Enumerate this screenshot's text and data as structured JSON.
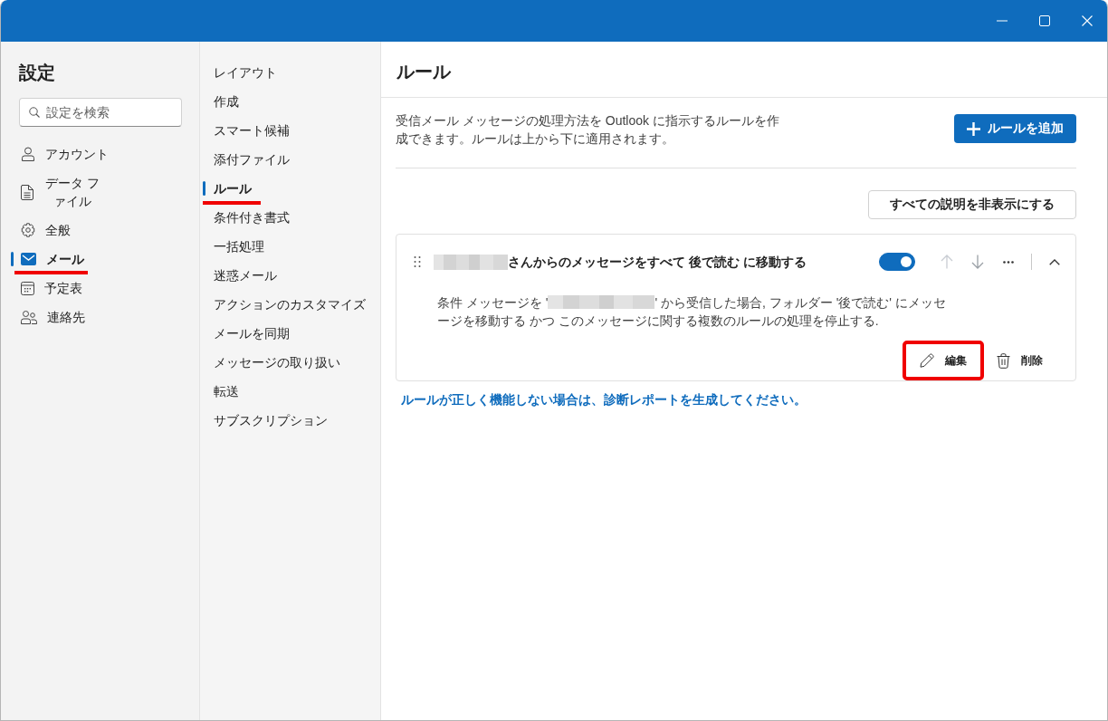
{
  "sidebar": {
    "title": "設定",
    "search": {
      "placeholder": "設定を検索"
    },
    "items": [
      {
        "label": "アカウント",
        "selected": false,
        "annotated": false
      },
      {
        "label": "データ ファイル",
        "selected": false,
        "annotated": false
      },
      {
        "label": "全般",
        "selected": false,
        "annotated": false
      },
      {
        "label": "メール",
        "selected": true,
        "annotated": true
      },
      {
        "label": "予定表",
        "selected": false,
        "annotated": false
      },
      {
        "label": "連絡先",
        "selected": false,
        "annotated": false
      }
    ]
  },
  "mail_settings": {
    "items": [
      {
        "label": "レイアウト",
        "selected": false,
        "annotated": false
      },
      {
        "label": "作成",
        "selected": false,
        "annotated": false
      },
      {
        "label": "スマート候補",
        "selected": false,
        "annotated": false
      },
      {
        "label": "添付ファイル",
        "selected": false,
        "annotated": false
      },
      {
        "label": "ルール",
        "selected": true,
        "annotated": true
      },
      {
        "label": "条件付き書式",
        "selected": false,
        "annotated": false
      },
      {
        "label": "一括処理",
        "selected": false,
        "annotated": false
      },
      {
        "label": "迷惑メール",
        "selected": false,
        "annotated": false
      },
      {
        "label": "アクションのカスタマイズ",
        "selected": false,
        "annotated": false
      },
      {
        "label": "メールを同期",
        "selected": false,
        "annotated": false
      },
      {
        "label": "メッセージの取り扱い",
        "selected": false,
        "annotated": false
      },
      {
        "label": "転送",
        "selected": false,
        "annotated": false
      },
      {
        "label": "サブスクリプション",
        "selected": false,
        "annotated": false
      }
    ]
  },
  "main": {
    "title": "ルール",
    "description": "受信メール メッセージの処理方法を Outlook に指示するルールを作成できます。ルールは上から下に適用されます。",
    "add_button": "ルールを追加",
    "hide_descriptions_button": "すべての説明を非表示にする",
    "rules": [
      {
        "sender_redacted": true,
        "title": "さんからのメッセージをすべて 後で読む に移動する",
        "on": true,
        "expanded": true,
        "move_up_disabled": true,
        "move_down_disabled": false,
        "condition_before": "条件 メッセージを '",
        "condition_sender_redacted": true,
        "condition_after": "' から受信した場合, フォルダー '後で読む' にメッセージを移動する かつ このメッセージに関する複数のルールの処理を停止する.",
        "actions": [
          {
            "kind": "edit",
            "label": "編集",
            "annotated": true
          },
          {
            "kind": "delete",
            "label": "削除",
            "annotated": false
          }
        ]
      }
    ],
    "help_link": "ルールが正しく機能しない場合は、診断レポートを生成してください。"
  }
}
